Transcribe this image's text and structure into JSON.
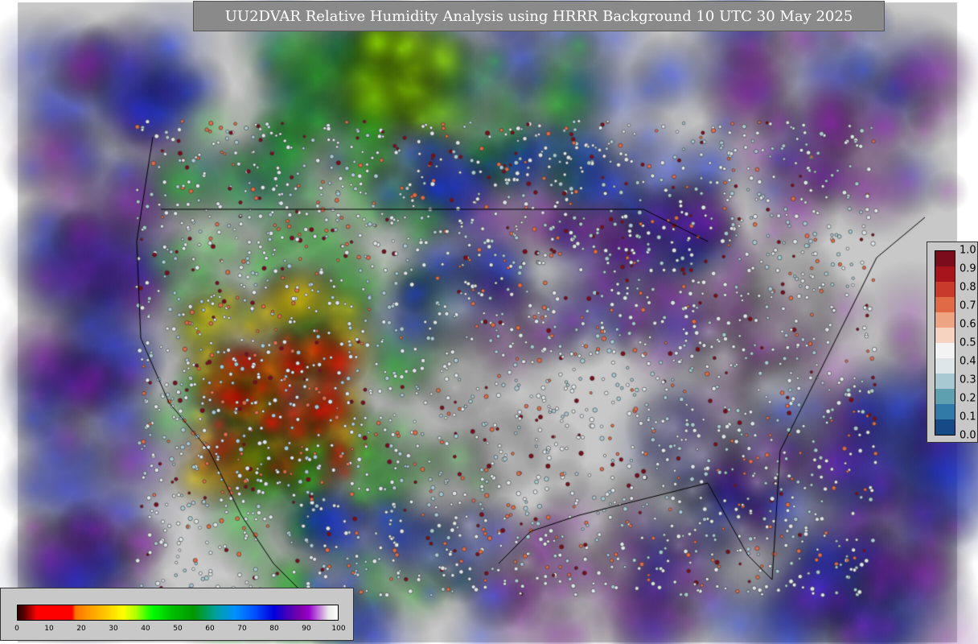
{
  "title": "UU2DVAR Relative Humidity Analysis using HRRR Background 10 UTC 30 May 2025",
  "rh_colorbar": {
    "ticks": [
      "0",
      "10",
      "20",
      "30",
      "40",
      "50",
      "60",
      "70",
      "80",
      "90",
      "100"
    ]
  },
  "prob_colorbar": {
    "ticks": [
      "1.0",
      "0.9",
      "0.8",
      "0.7",
      "0.6",
      "0.5",
      "0.4",
      "0.3",
      "0.2",
      "0.1",
      "0.0"
    ],
    "colors": [
      "#7a0c1c",
      "#a8141c",
      "#c83a2a",
      "#e06a45",
      "#eea383",
      "#f6d3c0",
      "#f3f3f3",
      "#dfe6ea",
      "#a8c8d2",
      "#5fa0b0",
      "#2f7aa6",
      "#154a86"
    ]
  },
  "colors": {
    "ocean_bg": "#c8c8c8",
    "desert_red": "#ff0000",
    "dry_yellow": "#ffdd00",
    "moist_green": "#11cc11",
    "humid_blue": "#1030ff",
    "saturated_purple": "#8a10b0"
  }
}
